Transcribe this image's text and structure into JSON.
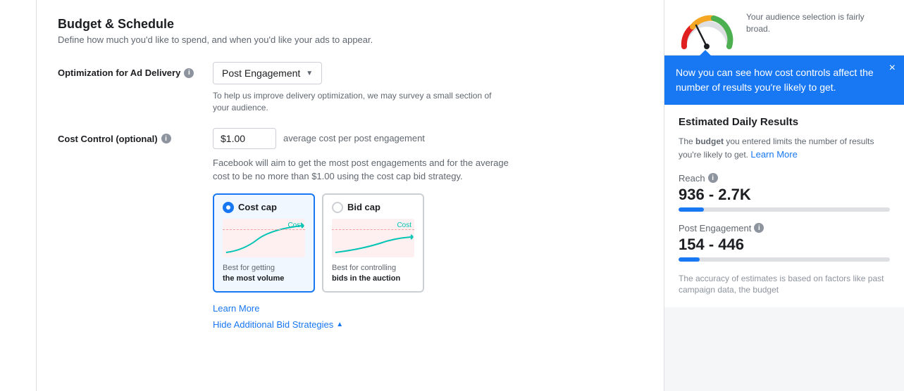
{
  "sidebar": {},
  "section": {
    "title": "Budget & Schedule",
    "subtitle": "Define how much you'd like to spend, and when you'd like your ads to appear."
  },
  "optimization": {
    "label": "Optimization for Ad Delivery",
    "dropdown_value": "Post Engagement",
    "helper": "To help us improve delivery optimization, we may survey a small section of your audience."
  },
  "cost_control": {
    "label": "Cost Control (optional)",
    "input_value": "$1.00",
    "suffix": "average cost per post engagement",
    "description": "Facebook will aim to get the most post engagements and for the average cost to be no more than $1.00 using the cost cap bid strategy.",
    "cards": [
      {
        "id": "cost-cap",
        "label": "Cost cap",
        "selected": true,
        "chart_cost_label": "Cost",
        "footer": "Best for getting",
        "footer_bold": "the most volume"
      },
      {
        "id": "bid-cap",
        "label": "Bid cap",
        "selected": false,
        "chart_cost_label": "Cost",
        "footer": "Best for controlling",
        "footer_bold": "bids in the auction"
      }
    ]
  },
  "links": {
    "learn_more": "Learn More",
    "hide_strategies": "Hide Additional Bid Strategies"
  },
  "right_panel": {
    "audience_text": "Your audience selection is fairly broad.",
    "tooltip": {
      "message": "Now you can see how cost controls affect the number of results you're likely to get.",
      "close": "×"
    },
    "estimated": {
      "title": "Estimated Daily Results",
      "description_prefix": "The ",
      "description_bold": "budget",
      "description_suffix": " you entered limits the number of results you're likely to get.",
      "learn_more": "Learn More",
      "metrics": [
        {
          "label": "Reach",
          "value": "936 - 2.7K",
          "fill_percent": 12
        },
        {
          "label": "Post Engagement",
          "value": "154 - 446",
          "fill_percent": 10
        }
      ],
      "footer": "The accuracy of estimates is based on factors like past campaign data, the budget"
    }
  }
}
